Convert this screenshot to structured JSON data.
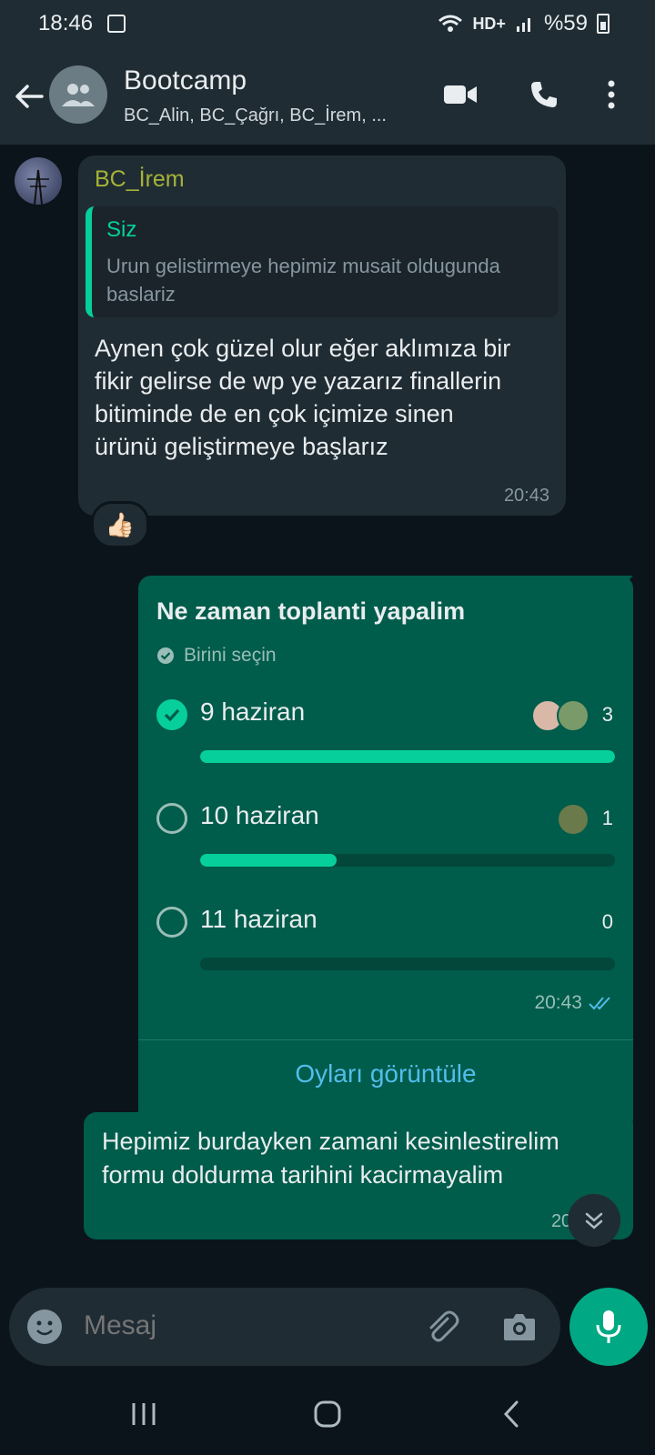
{
  "status_bar": {
    "time": "18:46",
    "network": "HD+",
    "battery": "%59",
    "icons": [
      "image-icon",
      "wifi-icon",
      "signal-icon",
      "battery-icon"
    ]
  },
  "header": {
    "title": "Bootcamp",
    "subtitle": "BC_Alin, BC_Çağrı, BC_İrem, ...",
    "icons": [
      "back-arrow-icon",
      "group-avatar-icon",
      "video-call-icon",
      "phone-icon",
      "more-icon"
    ]
  },
  "incoming_message": {
    "sender": "BC_İrem",
    "quote_author": "Siz",
    "quote_text": "Urun gelistirmeye hepimiz musait oldugunda baslariz",
    "text": "Aynen çok güzel olur eğer aklımıza bir fikir gelirse de wp ye yazarız finallerin bitiminde de en çok içimize sinen ürünü geliştirmeye başlarız",
    "time": "20:43",
    "reaction": "👍🏻"
  },
  "poll": {
    "question": "Ne zaman toplanti yapalim",
    "hint": "Birini seçin",
    "options": [
      {
        "label": "9 haziran",
        "count": "3",
        "fraction": 1.0,
        "selected": true
      },
      {
        "label": "10 haziran",
        "count": "1",
        "fraction": 0.33,
        "selected": false
      },
      {
        "label": "11 haziran",
        "count": "0",
        "fraction": 0.0,
        "selected": false
      }
    ],
    "time": "20:43",
    "view_votes": "Oyları görüntüle"
  },
  "outgoing_message": {
    "text": "Hepimiz burdayken zamani kesinlestirelim formu doldurma tarihini kacirmayalim",
    "time": "20:44"
  },
  "composer": {
    "placeholder": "Mesaj"
  },
  "colors": {
    "accent": "#00a884",
    "outgoing_bubble": "#005c4b",
    "incoming_bubble": "#202c33",
    "background": "#0b141a",
    "link": "#53bdeb"
  }
}
